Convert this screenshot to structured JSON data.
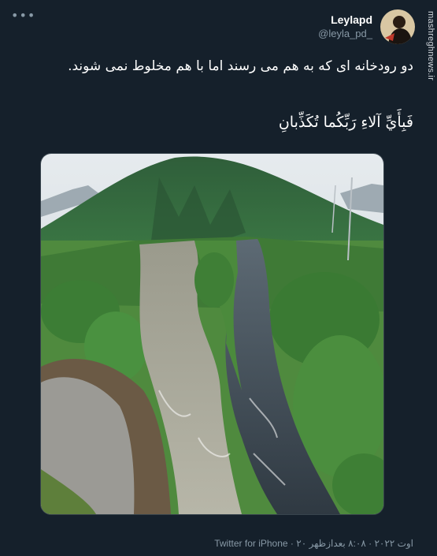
{
  "tweet": {
    "display_name": "Leylapd",
    "handle": "@leyla_pd_",
    "text": "دو رودخانه ای که به هم می رسند اما با هم مخلوط نمی شوند.",
    "quote": "فَبِأَيِّ آلاءِ رَبِّكُما تُكَذِّبانِ",
    "time": "۸:۰۸ بعدازظهر",
    "date": "۲۰ اوت ۲۰۲۲",
    "separator": "·",
    "source": "Twitter for iPhone",
    "more_icon": "more-horizontal-icon"
  },
  "watermark": "mashreghnews.ir",
  "colors": {
    "background": "#15202b",
    "text": "#ffffff",
    "muted": "#8899a6",
    "border": "#38444d"
  }
}
